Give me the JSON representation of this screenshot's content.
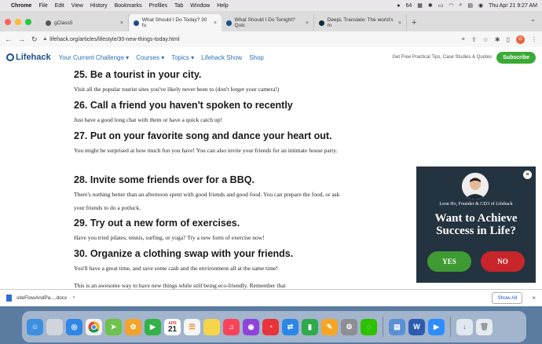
{
  "menubar": {
    "app": "Chrome",
    "items": [
      "File",
      "Edit",
      "View",
      "History",
      "Bookmarks",
      "Profiles",
      "Tab",
      "Window",
      "Help"
    ],
    "battery_badge": "64",
    "clock": "Thu Apr 21  9:27 AM"
  },
  "tabs": [
    {
      "label": "gClass5",
      "color": "#555555"
    },
    {
      "label": "What Should I Do Today? 30 fu",
      "color": "#1a4f8c"
    },
    {
      "label": "What Should I Do Tonight? Quic",
      "color": "#1a4f8c"
    },
    {
      "label": "DeepL Translate: The world's m",
      "color": "#0f2b46"
    }
  ],
  "address": {
    "url": "lifehack.org/articles/lifestyle/30-new-things-today.html",
    "profile_letter": "G"
  },
  "site": {
    "logo": "Lifehack",
    "nav": [
      "Your Current Challenge ▾",
      "Courses ▾",
      "Topics ▾",
      "Lifehack Show",
      "Shop"
    ],
    "tagline": "Get Free Practical Tips, Case Studies & Quotes",
    "subscribe": "Subscribe"
  },
  "article": [
    {
      "heading": "25. Be a tourist in your city.",
      "body": "Visit all the popular tourist sites you've likely never been to (don't forget your camera!)"
    },
    {
      "heading": "26. Call a friend you haven't spoken to recently",
      "body": "Just have a good long chat with them or have a quick catch up!"
    },
    {
      "heading": "27. Put on your favorite song and dance your heart out.",
      "body": "You might be surprised at how much fun you have! You can also invite your friends for an intimate house party."
    },
    {
      "heading": "28. Invite some friends over for a BBQ.",
      "body": "There's nothing better than an afternoon spent with good friends and good food. You can prepare the food, or ask your friends to do a potluck."
    },
    {
      "heading": "29. Try out a new form of exercises.",
      "body": "Have you tried pilates, tennis, surfing, or yoga? Try a new form of exercise now!"
    },
    {
      "heading": "30. Organize a clothing swap with your friends.",
      "body": "You'll have a great time, and save some cash and the environment all at the same time!"
    },
    {
      "heading": "",
      "body": "This is an awesome way to have new things while still being eco-friendly. Remember that"
    }
  ],
  "popup": {
    "byline": "Leon Ho, Founder & CEO of Lifehack",
    "headline": "Want to Achieve Success in Life?",
    "yes": "YES",
    "no": "NO"
  },
  "downloads": {
    "file": "siteFlowAndPa....docx",
    "show_all": "Show All"
  },
  "dock": {
    "calendar_month": "APR",
    "calendar_day": "21",
    "icons": [
      "finder-icon",
      "launchpad-icon",
      "safari-icon",
      "chrome-icon",
      "maps-icon",
      "photos-icon",
      "facetime-icon",
      "calendar-icon",
      "reminders-icon",
      "notes-icon",
      "music-icon",
      "podcasts-icon",
      "focus-icon",
      "translate-icon",
      "numbers-icon",
      "pages-icon",
      "settings-icon",
      "wechat-icon",
      "preview-icon",
      "word-icon",
      "zoom-icon",
      "downloads-icon",
      "trash-icon"
    ]
  }
}
